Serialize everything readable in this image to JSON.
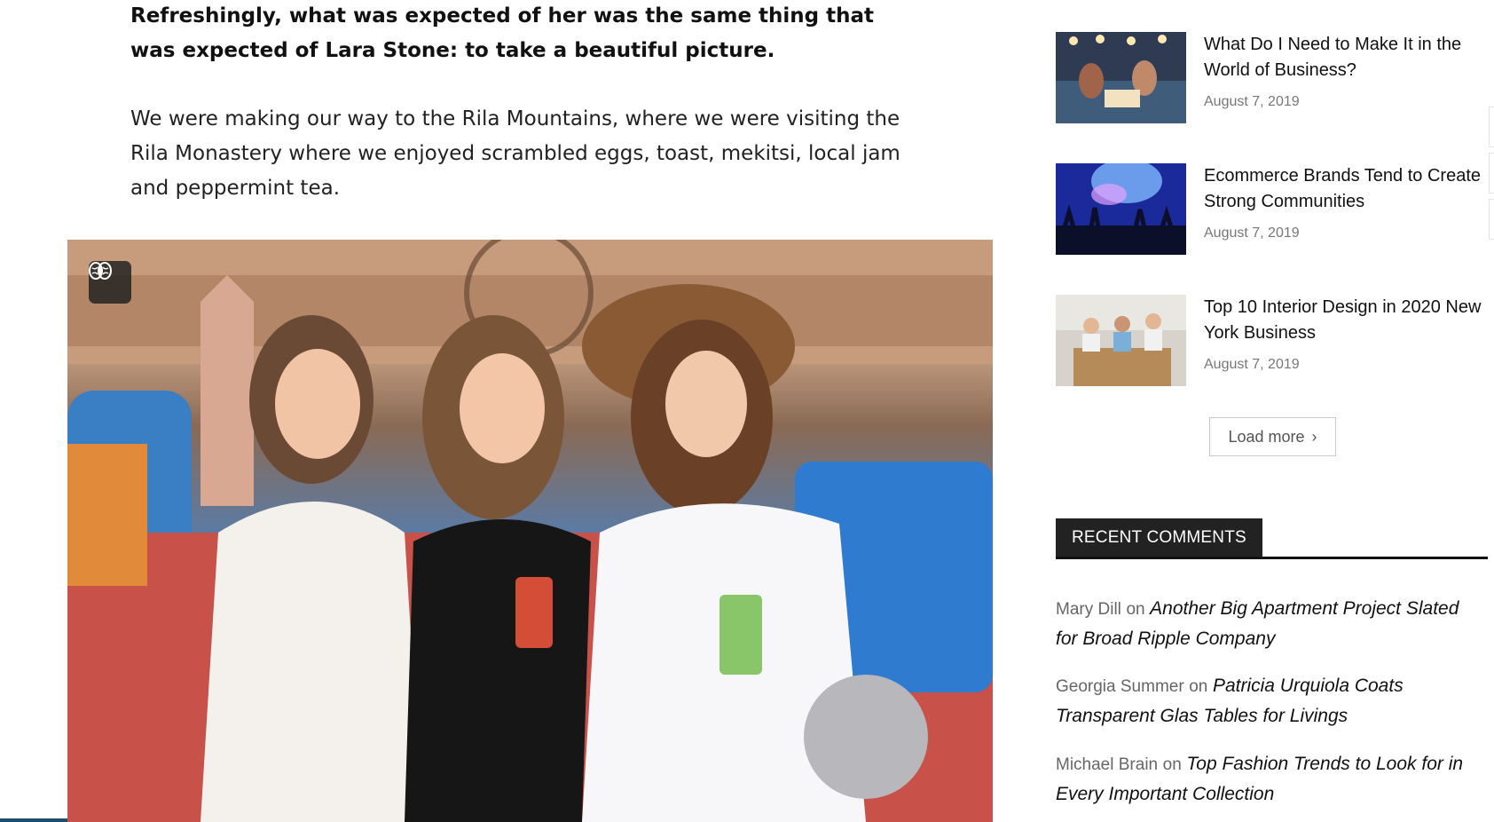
{
  "article": {
    "lead": "Refreshingly, what was expected of her was the same thing that was expected of Lara Stone: to take a beautiful picture.",
    "paragraph": "We were making our way to the Rila Mountains, where we were visiting the Rila Monastery where we enjoyed scrambled eggs, toast, mekitsi, local jam and peppermint tea.",
    "image_badge_icon": "brain-icon"
  },
  "sidebar": {
    "posts": [
      {
        "title": "What Do I Need to Make It in the World of Business?",
        "date": "August 7, 2019"
      },
      {
        "title": "Ecommerce Brands Tend to Create Strong Communities",
        "date": "August 7, 2019"
      },
      {
        "title": "Top 10 Interior Design in 2020 New York Business",
        "date": "August 7, 2019"
      }
    ],
    "load_more": "Load more",
    "recent_comments": {
      "heading": "RECENT COMMENTS",
      "items": [
        {
          "author": "Mary Dill",
          "on": "on",
          "title": "Another Big Apartment Project Slated for Broad Ripple Company"
        },
        {
          "author": "Georgia Summer",
          "on": "on",
          "title": "Patricia Urquiola Coats Transparent Glas Tables for Livings"
        },
        {
          "author": "Michael Brain",
          "on": "on",
          "title": "Top Fashion Trends to Look for in Every Important Collection"
        }
      ]
    }
  },
  "colors": {
    "heading_bg": "#222222",
    "accent_line": "#111111",
    "date": "#777777"
  }
}
